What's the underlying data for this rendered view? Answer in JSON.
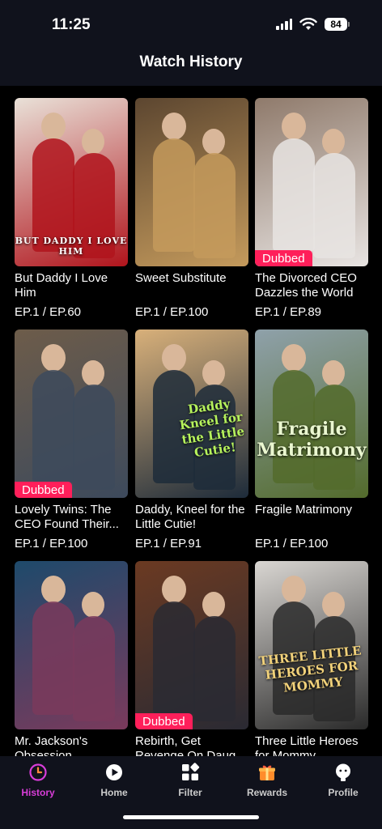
{
  "status_bar": {
    "time": "11:25",
    "battery": "84"
  },
  "header": {
    "title": "Watch History"
  },
  "dramas": [
    {
      "title": "But Daddy I Love Him",
      "episode": "EP.1 / EP.60",
      "badge": "",
      "poster_text": "BUT DADDY I LOVE HIM",
      "colors": [
        "#e9e1d8",
        "#b0141c"
      ]
    },
    {
      "title": "Sweet Substitute",
      "episode": "EP.1 / EP.100",
      "badge": "",
      "poster_text": "",
      "colors": [
        "#5c4630",
        "#c49a5c"
      ]
    },
    {
      "title": "The Divorced CEO Dazzles the World",
      "episode": "EP.1 / EP.89",
      "badge": "Dubbed",
      "poster_text": "",
      "colors": [
        "#8f7a6b",
        "#e8e4e2"
      ]
    },
    {
      "title": "Lovely Twins: The CEO Found Their...",
      "episode": "EP.1 / EP.100",
      "badge": "Dubbed",
      "poster_text": "",
      "colors": [
        "#6d5c4a",
        "#3d4a5c"
      ]
    },
    {
      "title": "Daddy, Kneel for the Little Cutie!",
      "episode": "EP.1 / EP.91",
      "badge": "",
      "poster_text": "Daddy Kneel for the Little Cutie!",
      "colors": [
        "#d8b07a",
        "#1d2b3a"
      ]
    },
    {
      "title": "Fragile Matrimony",
      "episode": "EP.1 / EP.100",
      "badge": "",
      "poster_text": "Fragile Matrimony",
      "colors": [
        "#8fa1aa",
        "#536b2c"
      ]
    },
    {
      "title": "Mr. Jackson's Obsession",
      "episode": "",
      "badge": "",
      "poster_text": "",
      "colors": [
        "#1e4a6b",
        "#7a3a5c"
      ]
    },
    {
      "title": "Rebirth, Get Revenge On Daug...",
      "episode": "",
      "badge": "Dubbed",
      "poster_text": "",
      "colors": [
        "#6b3a22",
        "#2a2a33"
      ]
    },
    {
      "title": "Three Little Heroes for Mommy",
      "episode": "",
      "badge": "",
      "poster_text": "THREE LITTLE HEROES FOR MOMMY",
      "colors": [
        "#d9d6d2",
        "#2a2a2a"
      ]
    }
  ],
  "tabs": [
    {
      "label": "History",
      "icon": "history-icon",
      "active": true
    },
    {
      "label": "Home",
      "icon": "play-circle-icon",
      "active": false
    },
    {
      "label": "Filter",
      "icon": "grid-icon",
      "active": false
    },
    {
      "label": "Rewards",
      "icon": "gift-icon",
      "active": false
    },
    {
      "label": "Profile",
      "icon": "profile-icon",
      "active": false
    }
  ],
  "colors": {
    "accent": "#d83dd8",
    "badge": "#ff1f5a",
    "bar_bg": "#10121c"
  }
}
